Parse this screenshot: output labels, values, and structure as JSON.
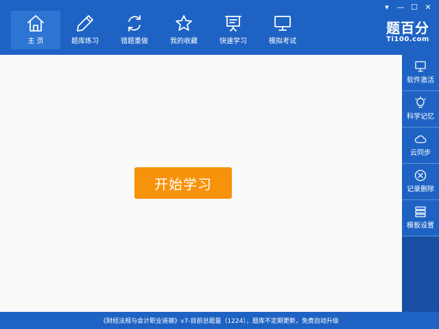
{
  "window_controls": {
    "menu": "▾",
    "minimize": "—",
    "maximize": "☐",
    "close": "✕"
  },
  "nav": {
    "items": [
      {
        "label": "主  页",
        "icon": "home-icon"
      },
      {
        "label": "题库练习",
        "icon": "pencil-icon"
      },
      {
        "label": "错题重做",
        "icon": "refresh-icon"
      },
      {
        "label": "我的收藏",
        "icon": "star-icon"
      },
      {
        "label": "快速学习",
        "icon": "presentation-icon"
      },
      {
        "label": "模拟考试",
        "icon": "monitor-icon"
      }
    ]
  },
  "brand": {
    "name": "题百分",
    "url": "Ti100.com"
  },
  "main": {
    "start_button": "开始学习"
  },
  "sidebar": {
    "items": [
      {
        "label": "软件激活",
        "icon": "monitor-icon"
      },
      {
        "label": "科学记忆",
        "icon": "lightbulb-icon"
      },
      {
        "label": "云同步",
        "icon": "cloud-icon"
      },
      {
        "label": "记录删除",
        "icon": "close-circle-icon"
      },
      {
        "label": "模板设置",
        "icon": "layers-icon"
      }
    ]
  },
  "status": {
    "text": "《财经法规与会计职业道德》v7-目前总题量（1224），题库不定期更新，免费自动升级"
  },
  "colors": {
    "header": "#1e63c4",
    "sidebar_bg": "#1a4fa6",
    "content_bg": "#fafafa",
    "accent": "#f7920b"
  }
}
